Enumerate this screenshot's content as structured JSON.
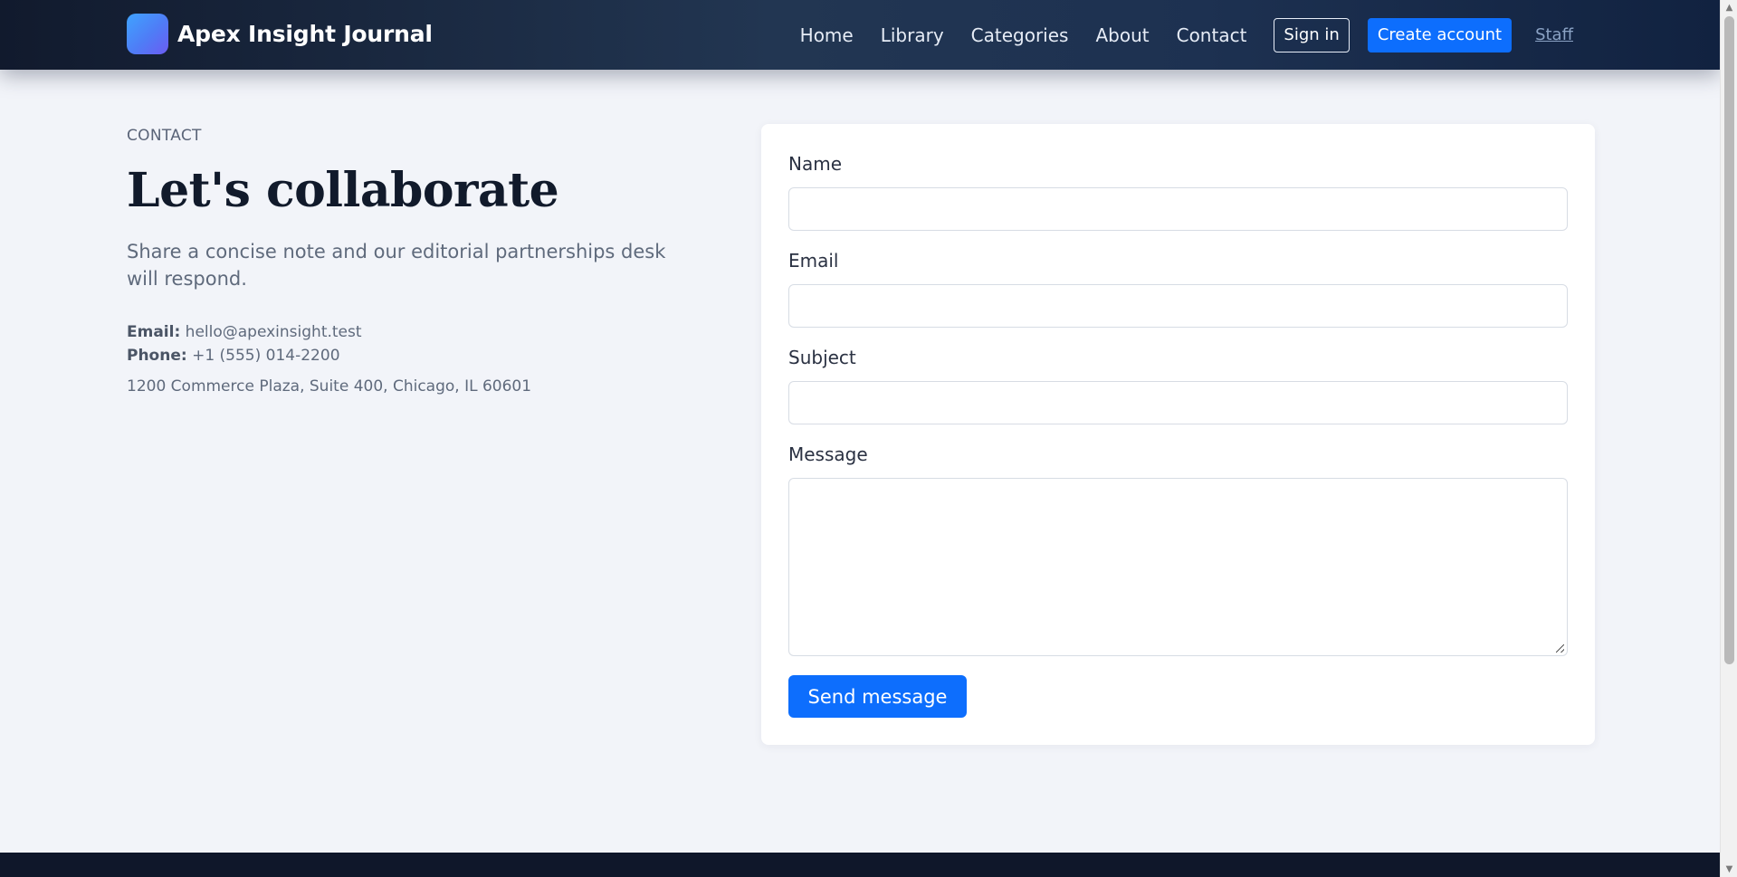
{
  "header": {
    "brand_name": "Apex Insight Journal",
    "logo_icon": "brand-logo-icon",
    "nav": [
      "Home",
      "Library",
      "Categories",
      "About",
      "Contact"
    ],
    "sign_in_label": "Sign in",
    "create_account_label": "Create account",
    "staff_label": "Staff"
  },
  "intro": {
    "eyebrow": "CONTACT",
    "title": "Let's collaborate",
    "description": "Share a concise note and our editorial partnerships desk will respond.",
    "email_label": "Email:",
    "email_value": "hello@apexinsight.test",
    "phone_label": "Phone:",
    "phone_value": "+1 (555) 014-2200",
    "address": "1200 Commerce Plaza, Suite 400, Chicago, IL 60601"
  },
  "form": {
    "name_label": "Name",
    "name_value": "",
    "email_label": "Email",
    "email_value": "",
    "subject_label": "Subject",
    "subject_value": "",
    "message_label": "Message",
    "message_value": "",
    "submit_label": "Send message"
  },
  "colors": {
    "accent": "#0d6efd",
    "header_dark": "#111a2d",
    "footer": "#0f172a",
    "page_background": "#f2f4f9"
  }
}
